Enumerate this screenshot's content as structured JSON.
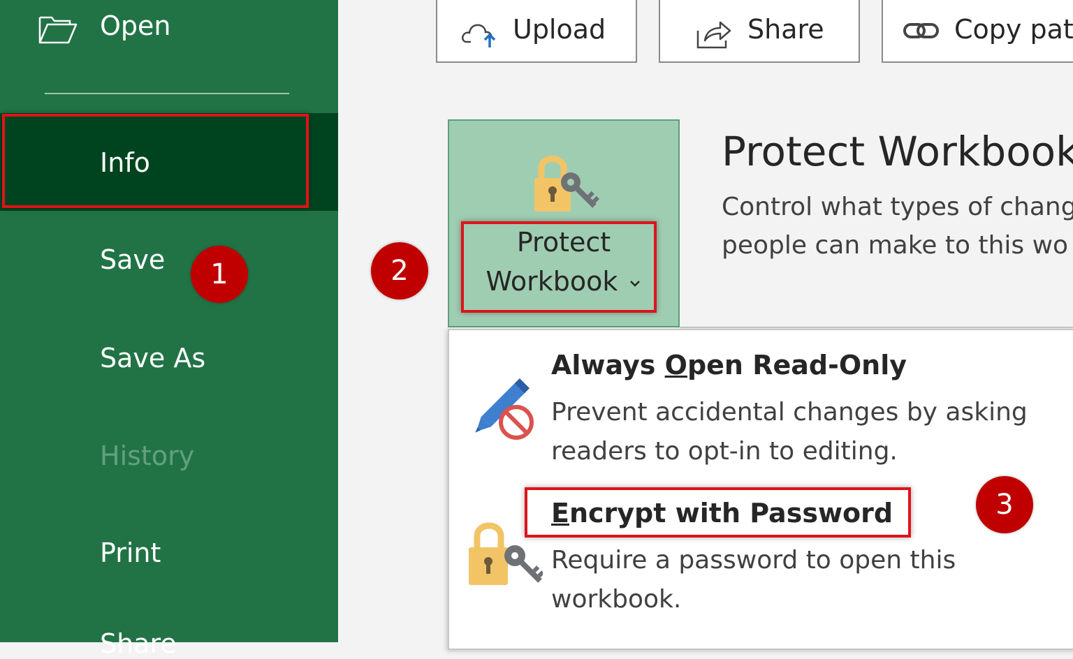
{
  "sidebar": {
    "open_label": "Open",
    "items": [
      {
        "label": "Info"
      },
      {
        "label": "Save"
      },
      {
        "label": "Save As"
      },
      {
        "label": "History"
      },
      {
        "label": "Print"
      },
      {
        "label": "Share"
      }
    ]
  },
  "toolbar": {
    "upload_label": "Upload",
    "share_label": "Share",
    "copy_path_label": "Copy pat"
  },
  "protect": {
    "button_line1": "Protect",
    "button_line2": "Workbook",
    "title": "Protect Workbook",
    "desc_line1": "Control what types of chang",
    "desc_line2": "people can make to this wo"
  },
  "menu": {
    "items": [
      {
        "title_mnemonic": "O",
        "title_pre": "Always ",
        "title_post": "pen Read-Only",
        "desc_line1": "Prevent accidental changes by asking",
        "desc_line2": "readers to opt-in to editing."
      },
      {
        "title_mnemonic": "E",
        "title_post": "ncrypt with Password",
        "desc_line1": "Require a password to open this",
        "desc_line2": "workbook."
      }
    ]
  },
  "markers": [
    "1",
    "2",
    "3"
  ],
  "colors": {
    "sidebar_bg": "#217346",
    "selected_bg": "#00441f",
    "highlight_border": "#e0131a",
    "marker_bg": "#c00000",
    "protect_tile_bg": "#9fcdb2"
  }
}
